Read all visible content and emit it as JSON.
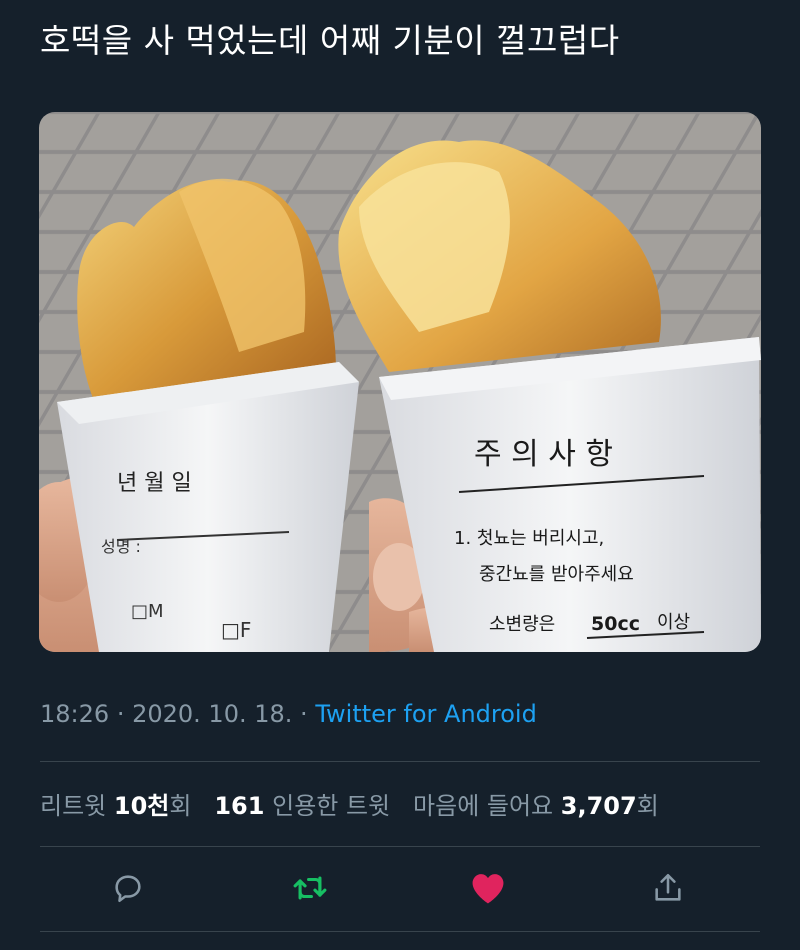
{
  "tweet": {
    "text": "호떡을 사 먹었는데 어째 기분이 껄끄럽다"
  },
  "photo": {
    "left_cup": {
      "label_year_month_day": "년 월 일",
      "name_label": "성명 :",
      "sex_m": "□M",
      "sex_f": "□F"
    },
    "right_cup": {
      "heading": "주 의 사 항",
      "line1": "1. 첫뇨는 버리시고,",
      "line2": "중간뇨를 받아주세요",
      "line3_prefix": "소변량은",
      "line3_value": "50cc",
      "line3_suffix": "이상"
    }
  },
  "meta": {
    "time": "18:26",
    "date": "2020. 10. 18.",
    "separator": "·",
    "source": "Twitter for Android"
  },
  "stats": {
    "retweets_label": "리트윗",
    "retweets_value": "10천",
    "retweets_suffix": "회",
    "quotes_value": "161",
    "quotes_label": "인용한 트윗",
    "likes_label": "마음에 들어요",
    "likes_value": "3,707",
    "likes_suffix": "회"
  },
  "colors": {
    "background": "#15202b",
    "muted": "#8899a6",
    "link": "#1da1f2",
    "retweet": "#17bf63",
    "like": "#e0245e"
  },
  "icons": [
    "reply-icon",
    "retweet-icon",
    "like-icon",
    "share-icon"
  ]
}
